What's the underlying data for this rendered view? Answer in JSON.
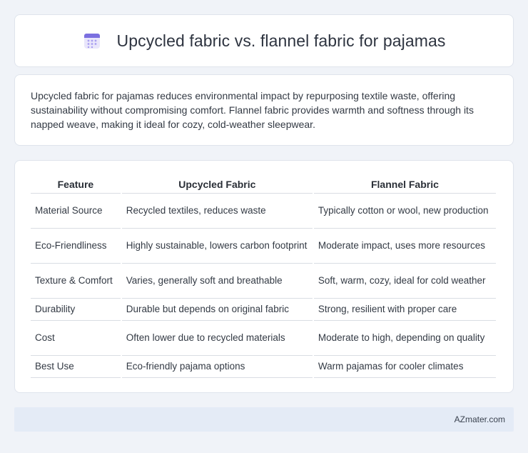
{
  "header": {
    "title": "Upcycled fabric vs. flannel fabric for pajamas",
    "icon": "calendar-icon"
  },
  "summary": {
    "text": "Upcycled fabric for pajamas reduces environmental impact by repurposing textile waste, offering sustainability without compromising comfort. Flannel fabric provides warmth and softness through its napped weave, making it ideal for cozy, cold-weather sleepwear."
  },
  "table": {
    "headers": [
      "Feature",
      "Upcycled Fabric",
      "Flannel Fabric"
    ],
    "rows": [
      [
        "Material Source",
        "Recycled textiles, reduces waste",
        "Typically cotton or wool, new production"
      ],
      [
        "Eco-Friendliness",
        "Highly sustainable, lowers carbon footprint",
        "Moderate impact, uses more resources"
      ],
      [
        "Texture & Comfort",
        "Varies, generally soft and breathable",
        "Soft, warm, cozy, ideal for cold weather"
      ],
      [
        "Durability",
        "Durable but depends on original fabric",
        "Strong, resilient with proper care"
      ],
      [
        "Cost",
        "Often lower due to recycled materials",
        "Moderate to high, depending on quality"
      ],
      [
        "Best Use",
        "Eco-friendly pajama options",
        "Warm pajamas for cooler climates"
      ]
    ]
  },
  "footer": {
    "brand": "AZmater.com"
  },
  "colors": {
    "background": "#f0f3f8",
    "card": "#ffffff",
    "footer_bg": "#e4ebf6",
    "icon_accent": "#7b6fe0"
  }
}
